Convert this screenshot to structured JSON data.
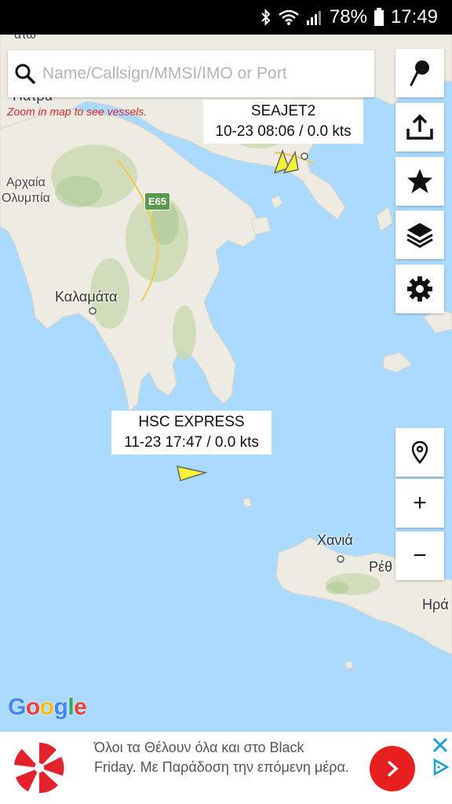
{
  "status_bar": {
    "battery": "78%",
    "time": "17:49",
    "icons": [
      "bluetooth-icon",
      "wifi-icon",
      "signal-icon",
      "battery-icon"
    ]
  },
  "search": {
    "placeholder": "Name/Callsign/MMSI/IMO or Port",
    "value": "",
    "hint": "Zoom in map to see vessels."
  },
  "map": {
    "places": {
      "patra": "Πάτρα",
      "archaia": "Αρχαία",
      "olympia": "Ολυμπία",
      "kalamata": "Καλαμάτα",
      "chania": "Χανιά",
      "rethymno": "Ρέθ",
      "iraklio": "Ηρά",
      "top_left": "άτω"
    },
    "road": "E65",
    "logo": "Google"
  },
  "vessels": [
    {
      "name": "SEAJET2",
      "info": "10-23 08:06 / 0.0 kts"
    },
    {
      "name": "HSC EXPRESS",
      "info": "11-23 17:47 / 0.0 kts"
    }
  ],
  "toolbar": {
    "right_buttons": [
      "pin-icon",
      "share-icon",
      "star-icon",
      "layers-icon",
      "gear-icon"
    ],
    "map_controls": {
      "locate": "location-icon",
      "zoom_in": "+",
      "zoom_out": "−"
    }
  },
  "ad": {
    "text": "Όλοι τα Θέλουν όλα και στο Black Friday. Με Παράδοση την επόμενη μέρα."
  },
  "colors": {
    "sea": "#aadaff",
    "land": "#f0ede6",
    "hint_red": "#e3222b",
    "vessel_yellow": "#f5f23a",
    "ad_red": "#e81f1f"
  }
}
